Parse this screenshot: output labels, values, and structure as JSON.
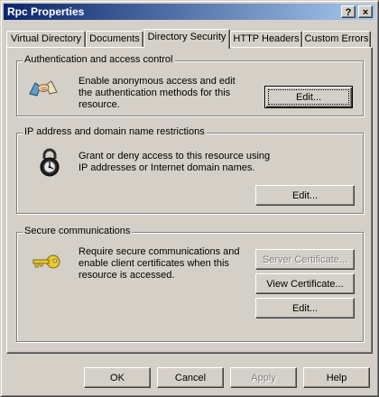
{
  "window": {
    "title": "Rpc Properties"
  },
  "titlebar_buttons": {
    "help": "?",
    "close": "×"
  },
  "tabs": [
    {
      "label": "Virtual Directory"
    },
    {
      "label": "Documents"
    },
    {
      "label": "Directory Security",
      "active": true
    },
    {
      "label": "HTTP Headers"
    },
    {
      "label": "Custom Errors"
    }
  ],
  "auth": {
    "title": "Authentication and access control",
    "description": "Enable anonymous access and edit the authentication methods for this resource.",
    "edit_label": "Edit..."
  },
  "ip": {
    "title": "IP address and domain name restrictions",
    "description": "Grant or deny access to this resource using IP addresses or Internet domain names.",
    "edit_label": "Edit..."
  },
  "secure": {
    "title": "Secure communications",
    "description": "Require secure communications and enable client certificates when this resource is accessed.",
    "server_cert_label": "Server Certificate...",
    "view_cert_label": "View Certificate...",
    "edit_label": "Edit..."
  },
  "footer": {
    "ok_label": "OK",
    "cancel_label": "Cancel",
    "apply_label": "Apply",
    "help_label": "Help"
  },
  "colors": {
    "title_gradient_start": "#0a246a",
    "title_gradient_end": "#a6caf0",
    "dialog_face": "#d4d0c8",
    "disabled_text": "#808080"
  }
}
